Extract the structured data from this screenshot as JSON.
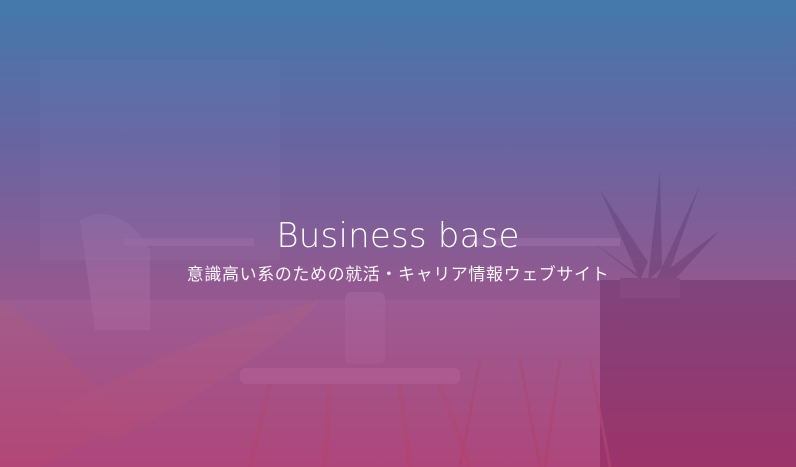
{
  "hero": {
    "title": "Business base",
    "subtitle": "意識高い系のための就活・キャリア情報ウェブサイト"
  },
  "colors": {
    "overlay_top": "#3c76ac",
    "overlay_mid": "#7a4f9a",
    "overlay_bottom": "#ac3470",
    "text": "#ffffff"
  }
}
